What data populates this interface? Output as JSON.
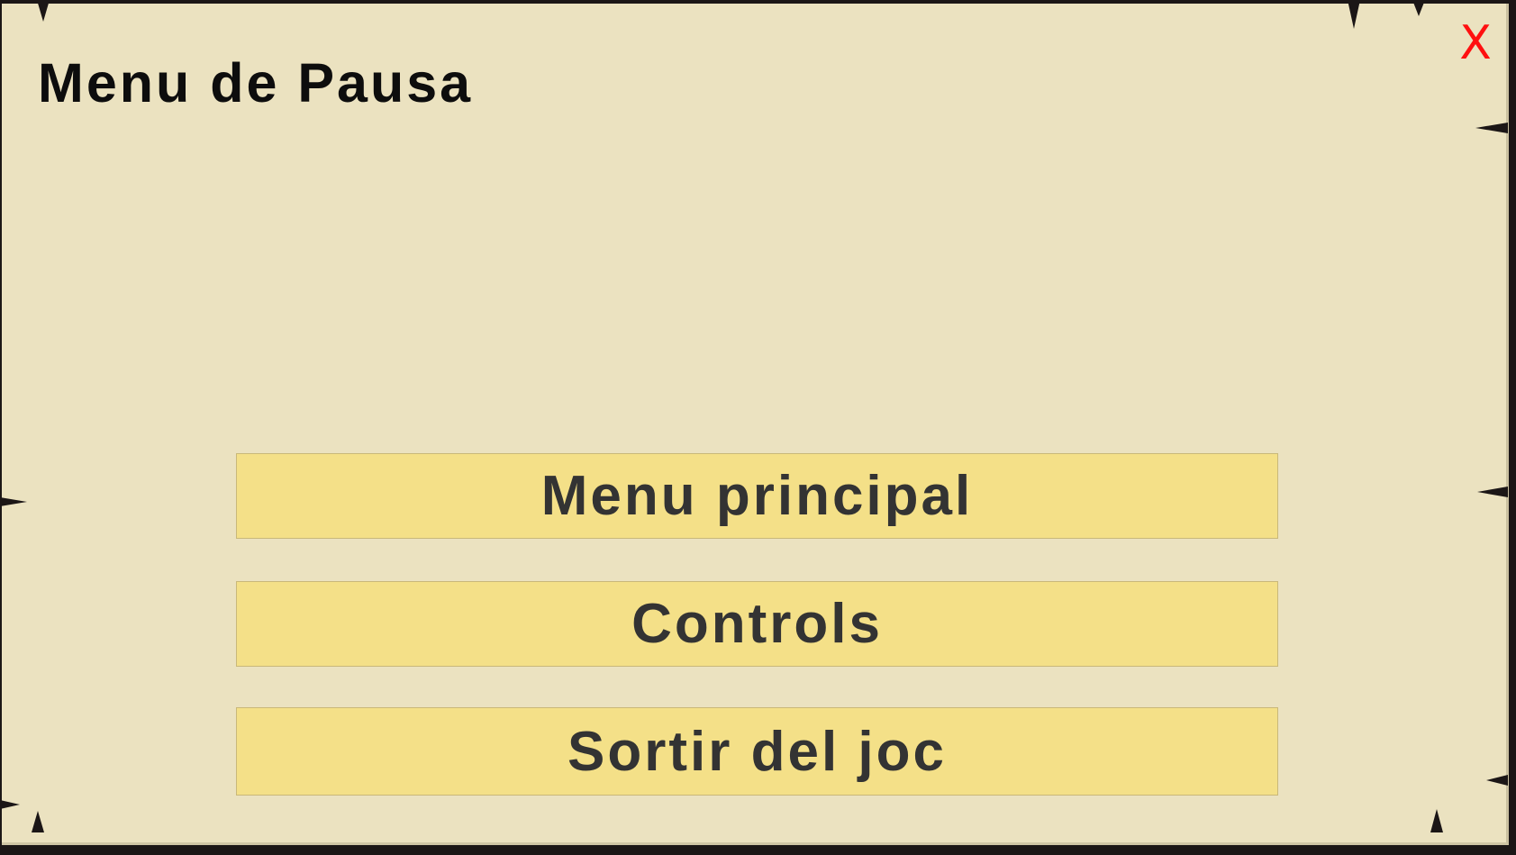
{
  "dialog": {
    "title": "Menu de Pausa",
    "close_label": "X"
  },
  "buttons": [
    {
      "label": "Menu principal"
    },
    {
      "label": "Controls"
    },
    {
      "label": "Sortir del joc"
    }
  ],
  "colors": {
    "panel_background": "#ebe2c0",
    "button_background": "#f4e088",
    "button_text": "#333333",
    "title_text": "#0d0d0d",
    "close_icon": "#ff1010",
    "frame": "#1b1616"
  }
}
